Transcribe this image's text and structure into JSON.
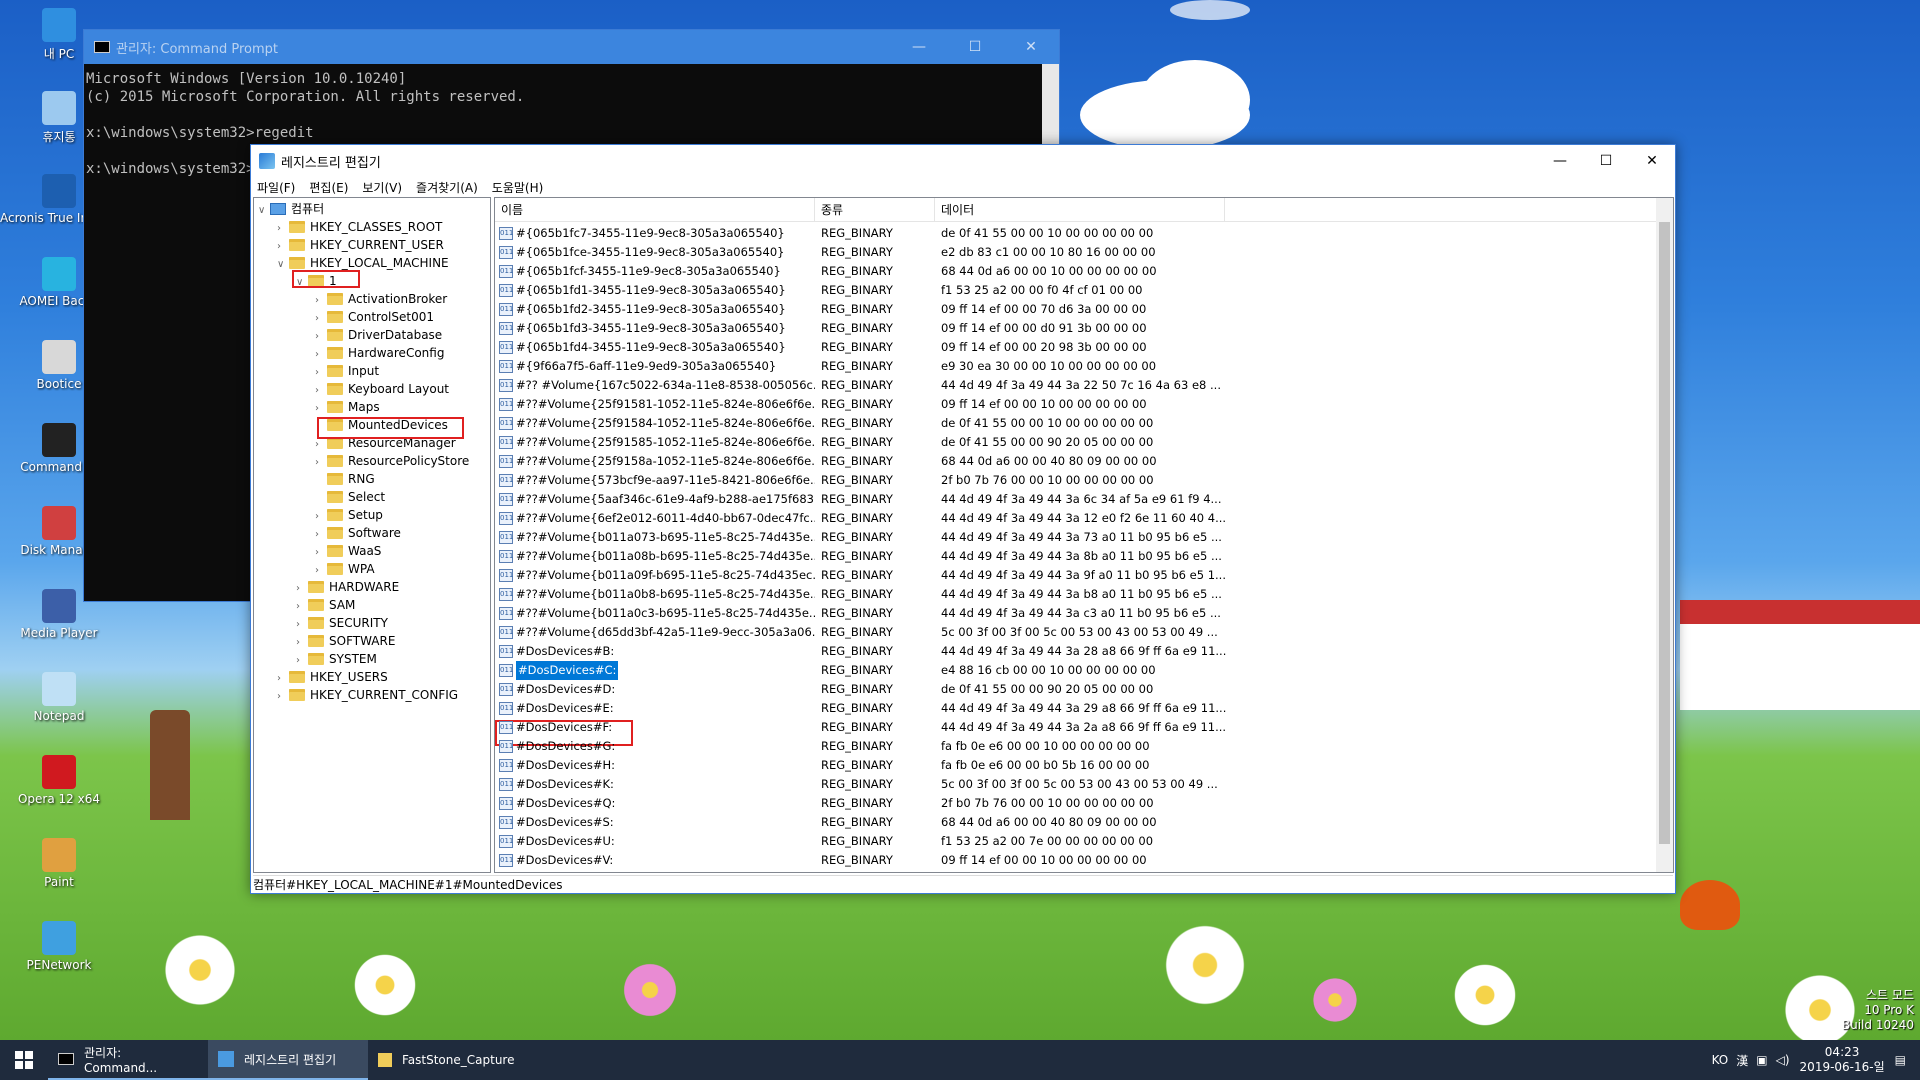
{
  "desktop": {
    "icons": [
      {
        "label": "내 PC",
        "icon": "computer-icon",
        "color": "#2f8fe0"
      },
      {
        "label": "휴지통",
        "icon": "recycle-bin-icon",
        "color": "#9cc9ef"
      },
      {
        "label": "Acronis True Image Home",
        "icon": "acronis-icon",
        "color": "#1d5fb0"
      },
      {
        "label": "AOMEI Backu",
        "icon": "aomei-icon",
        "color": "#28b3e0"
      },
      {
        "label": "Bootice",
        "icon": "bootice-icon",
        "color": "#d8d8d8"
      },
      {
        "label": "Command Pr",
        "icon": "command-prompt-icon",
        "color": "#222222"
      },
      {
        "label": "Disk Manage",
        "icon": "disk-management-icon",
        "color": "#d04040"
      },
      {
        "label": "Media Player",
        "icon": "media-player-icon",
        "color": "#3c5fa8"
      },
      {
        "label": "Notepad",
        "icon": "notepad-icon",
        "color": "#bfe0f5"
      },
      {
        "label": "Opera 12 x64",
        "icon": "opera-icon",
        "color": "#d0191f"
      },
      {
        "label": "Paint",
        "icon": "paint-icon",
        "color": "#e0a040"
      },
      {
        "label": "PENetwork",
        "icon": "network-icon",
        "color": "#3fa0e0"
      }
    ]
  },
  "cmd": {
    "title": "관리자: Command Prompt",
    "lines": [
      "Microsoft Windows [Version 10.0.10240]",
      "(c) 2015 Microsoft Corporation. All rights reserved.",
      "",
      "x:\\windows\\system32>regedit",
      "",
      "x:\\windows\\system32>"
    ]
  },
  "regedit": {
    "title": "레지스트리 편집기",
    "menu": [
      "파일(F)",
      "편집(E)",
      "보기(V)",
      "즐겨찾기(A)",
      "도움말(H)"
    ],
    "columns": [
      "이름",
      "종류",
      "데이터"
    ],
    "tree": [
      {
        "label": "컴퓨터",
        "depth": 0,
        "exp": "v",
        "kind": "pc"
      },
      {
        "label": "HKEY_CLASSES_ROOT",
        "depth": 1,
        "exp": ">"
      },
      {
        "label": "HKEY_CURRENT_USER",
        "depth": 1,
        "exp": ">"
      },
      {
        "label": "HKEY_LOCAL_MACHINE",
        "depth": 1,
        "exp": "v"
      },
      {
        "label": "1",
        "depth": 2,
        "exp": "v"
      },
      {
        "label": "ActivationBroker",
        "depth": 3,
        "exp": ">"
      },
      {
        "label": "ControlSet001",
        "depth": 3,
        "exp": ">"
      },
      {
        "label": "DriverDatabase",
        "depth": 3,
        "exp": ">"
      },
      {
        "label": "HardwareConfig",
        "depth": 3,
        "exp": ">"
      },
      {
        "label": "Input",
        "depth": 3,
        "exp": ">"
      },
      {
        "label": "Keyboard Layout",
        "depth": 3,
        "exp": ">"
      },
      {
        "label": "Maps",
        "depth": 3,
        "exp": ">"
      },
      {
        "label": "MountedDevices",
        "depth": 3,
        "exp": ""
      },
      {
        "label": "ResourceManager",
        "depth": 3,
        "exp": ">"
      },
      {
        "label": "ResourcePolicyStore",
        "depth": 3,
        "exp": ">"
      },
      {
        "label": "RNG",
        "depth": 3,
        "exp": ""
      },
      {
        "label": "Select",
        "depth": 3,
        "exp": ""
      },
      {
        "label": "Setup",
        "depth": 3,
        "exp": ">"
      },
      {
        "label": "Software",
        "depth": 3,
        "exp": ">"
      },
      {
        "label": "WaaS",
        "depth": 3,
        "exp": ">"
      },
      {
        "label": "WPA",
        "depth": 3,
        "exp": ">"
      },
      {
        "label": "HARDWARE",
        "depth": 2,
        "exp": ">"
      },
      {
        "label": "SAM",
        "depth": 2,
        "exp": ">"
      },
      {
        "label": "SECURITY",
        "depth": 2,
        "exp": ">"
      },
      {
        "label": "SOFTWARE",
        "depth": 2,
        "exp": ">"
      },
      {
        "label": "SYSTEM",
        "depth": 2,
        "exp": ">"
      },
      {
        "label": "HKEY_USERS",
        "depth": 1,
        "exp": ">"
      },
      {
        "label": "HKEY_CURRENT_CONFIG",
        "depth": 1,
        "exp": ">"
      }
    ],
    "rows": [
      [
        "#{065b1fc7-3455-11e9-9ec8-305a3a065540}",
        "REG_BINARY",
        "de 0f 41 55 00 00 10 00 00 00 00 00"
      ],
      [
        "#{065b1fce-3455-11e9-9ec8-305a3a065540}",
        "REG_BINARY",
        "e2 db 83 c1 00 00 10 80 16 00 00 00"
      ],
      [
        "#{065b1fcf-3455-11e9-9ec8-305a3a065540}",
        "REG_BINARY",
        "68 44 0d a6 00 00 10 00 00 00 00 00"
      ],
      [
        "#{065b1fd1-3455-11e9-9ec8-305a3a065540}",
        "REG_BINARY",
        "f1 53 25 a2 00 00 f0 4f cf 01 00 00"
      ],
      [
        "#{065b1fd2-3455-11e9-9ec8-305a3a065540}",
        "REG_BINARY",
        "09 ff 14 ef 00 00 70 d6 3a 00 00 00"
      ],
      [
        "#{065b1fd3-3455-11e9-9ec8-305a3a065540}",
        "REG_BINARY",
        "09 ff 14 ef 00 00 d0 91 3b 00 00 00"
      ],
      [
        "#{065b1fd4-3455-11e9-9ec8-305a3a065540}",
        "REG_BINARY",
        "09 ff 14 ef 00 00 20 98 3b 00 00 00"
      ],
      [
        "#{9f66a7f5-6aff-11e9-9ed9-305a3a065540}",
        "REG_BINARY",
        "e9 30 ea 30 00 00 10 00 00 00 00 00"
      ],
      [
        "#?? #Volume{167c5022-634a-11e8-8538-005056c...",
        "REG_BINARY",
        "44 4d 49 4f 3a 49 44 3a 22 50 7c 16 4a 63 e8 ..."
      ],
      [
        "#??#Volume{25f91581-1052-11e5-824e-806e6f6e...",
        "REG_BINARY",
        "09 ff 14 ef 00 00 10 00 00 00 00 00"
      ],
      [
        "#??#Volume{25f91584-1052-11e5-824e-806e6f6e...",
        "REG_BINARY",
        "de 0f 41 55 00 00 10 00 00 00 00 00"
      ],
      [
        "#??#Volume{25f91585-1052-11e5-824e-806e6f6e...",
        "REG_BINARY",
        "de 0f 41 55 00 00 90 20 05 00 00 00"
      ],
      [
        "#??#Volume{25f9158a-1052-11e5-824e-806e6f6e...",
        "REG_BINARY",
        "68 44 0d a6 00 00 40 80 09 00 00 00"
      ],
      [
        "#??#Volume{573bcf9e-aa97-11e5-8421-806e6f6e...",
        "REG_BINARY",
        "2f b0 7b 76 00 00 10 00 00 00 00 00"
      ],
      [
        "#??#Volume{5aaf346c-61e9-4af9-b288-ae175f683...",
        "REG_BINARY",
        "44 4d 49 4f 3a 49 44 3a 6c 34 af 5a e9 61 f9 4..."
      ],
      [
        "#??#Volume{6ef2e012-6011-4d40-bb67-0dec47fc...",
        "REG_BINARY",
        "44 4d 49 4f 3a 49 44 3a 12 e0 f2 6e 11 60 40 4..."
      ],
      [
        "#??#Volume{b011a073-b695-11e5-8c25-74d435e...",
        "REG_BINARY",
        "44 4d 49 4f 3a 49 44 3a 73 a0 11 b0 95 b6 e5 ..."
      ],
      [
        "#??#Volume{b011a08b-b695-11e5-8c25-74d435e...",
        "REG_BINARY",
        "44 4d 49 4f 3a 49 44 3a 8b a0 11 b0 95 b6 e5 ..."
      ],
      [
        "#??#Volume{b011a09f-b695-11e5-8c25-74d435ec...",
        "REG_BINARY",
        "44 4d 49 4f 3a 49 44 3a 9f a0 11 b0 95 b6 e5 1..."
      ],
      [
        "#??#Volume{b011a0b8-b695-11e5-8c25-74d435e...",
        "REG_BINARY",
        "44 4d 49 4f 3a 49 44 3a b8 a0 11 b0 95 b6 e5 ..."
      ],
      [
        "#??#Volume{b011a0c3-b695-11e5-8c25-74d435e...",
        "REG_BINARY",
        "44 4d 49 4f 3a 49 44 3a c3 a0 11 b0 95 b6 e5 ..."
      ],
      [
        "#??#Volume{d65dd3bf-42a5-11e9-9ecc-305a3a06...",
        "REG_BINARY",
        "5c 00 3f 00 3f 00 5c 00 53 00 43 00 53 00 49 ..."
      ],
      [
        "#DosDevices#B:",
        "REG_BINARY",
        "44 4d 49 4f 3a 49 44 3a 28 a8 66 9f ff 6a e9 11..."
      ],
      [
        "#DosDevices#C:",
        "REG_BINARY",
        "e4 88 16 cb 00 00 10 00 00 00 00 00"
      ],
      [
        "#DosDevices#D:",
        "REG_BINARY",
        "de 0f 41 55 00 00 90 20 05 00 00 00"
      ],
      [
        "#DosDevices#E:",
        "REG_BINARY",
        "44 4d 49 4f 3a 49 44 3a 29 a8 66 9f ff 6a e9 11..."
      ],
      [
        "#DosDevices#F:",
        "REG_BINARY",
        "44 4d 49 4f 3a 49 44 3a 2a a8 66 9f ff 6a e9 11..."
      ],
      [
        "#DosDevices#G:",
        "REG_BINARY",
        "fa fb 0e e6 00 00 10 00 00 00 00 00"
      ],
      [
        "#DosDevices#H:",
        "REG_BINARY",
        "fa fb 0e e6 00 00 b0 5b 16 00 00 00"
      ],
      [
        "#DosDevices#K:",
        "REG_BINARY",
        "5c 00 3f 00 3f 00 5c 00 53 00 43 00 53 00 49 ..."
      ],
      [
        "#DosDevices#Q:",
        "REG_BINARY",
        "2f b0 7b 76 00 00 10 00 00 00 00 00"
      ],
      [
        "#DosDevices#S:",
        "REG_BINARY",
        "68 44 0d a6 00 00 40 80 09 00 00 00"
      ],
      [
        "#DosDevices#U:",
        "REG_BINARY",
        "f1 53 25 a2 00 7e 00 00 00 00 00 00"
      ],
      [
        "#DosDevices#V:",
        "REG_BINARY",
        "09 ff 14 ef 00 00 10 00 00 00 00 00"
      ]
    ],
    "selected_row": "#DosDevices#C:",
    "statusbar": "컴퓨터#HKEY_LOCAL_MACHINE#1#MountedDevices"
  },
  "taskbar": {
    "items": [
      "관리자: Command...",
      "레지스트리 편집기",
      "FastStone_Capture"
    ],
    "ime": "KO",
    "time": "04:23",
    "date": "2019-06-16-일",
    "build_lines": [
      "스트 모드",
      "10 Pro K",
      "Build 10240"
    ]
  },
  "colors": {
    "selection": "#0078d7",
    "highlight": "#e02020"
  }
}
